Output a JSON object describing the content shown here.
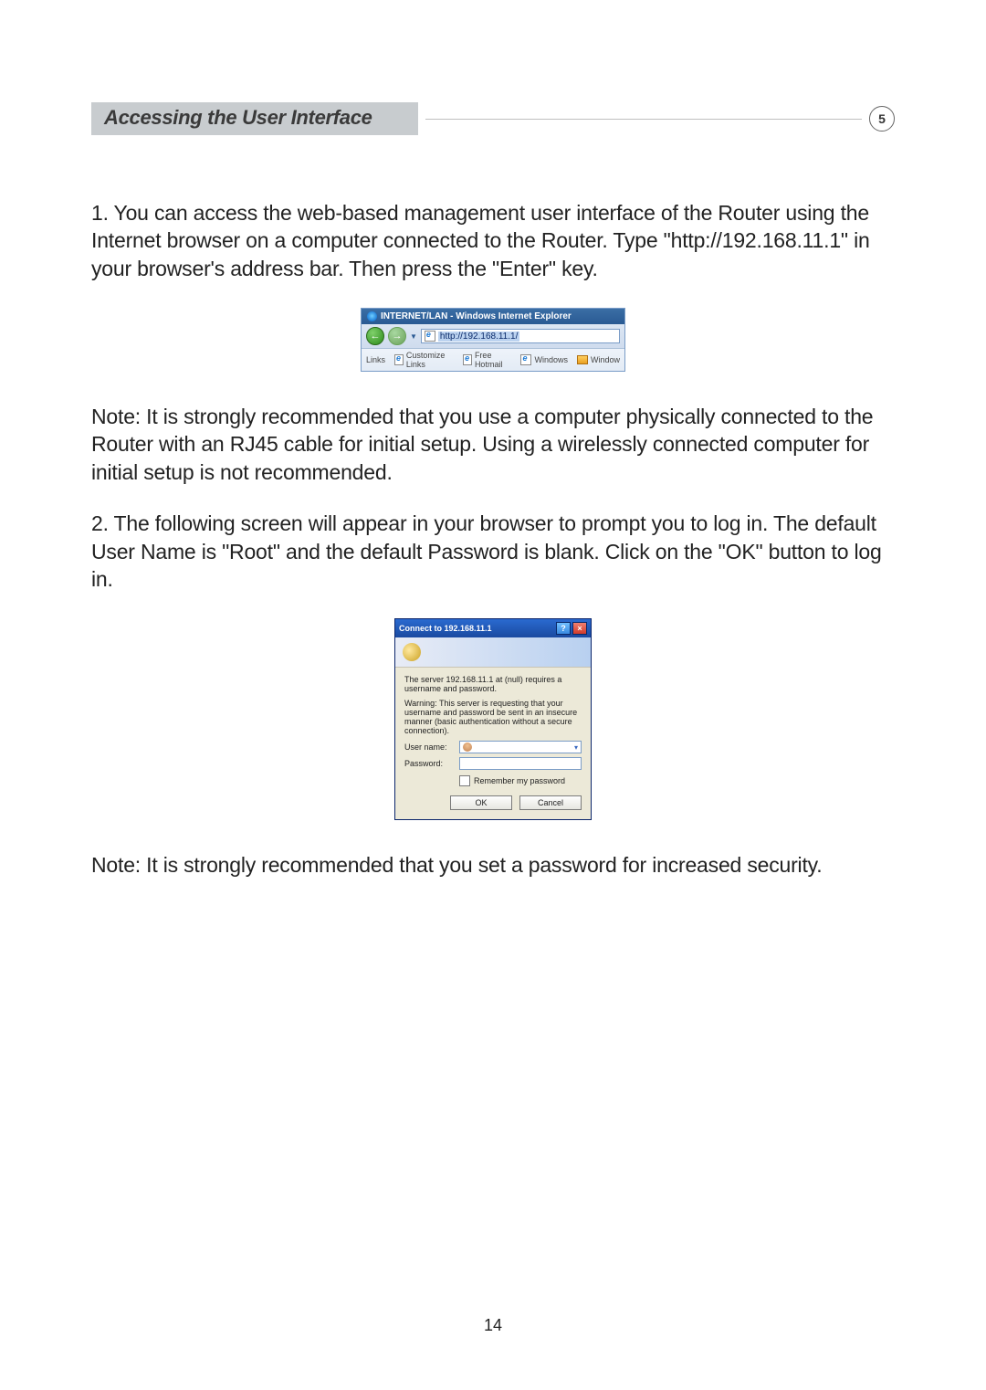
{
  "section": {
    "title": "Accessing the User Interface",
    "number": "5"
  },
  "paragraphs": {
    "p1": "1. You can access the web-based management user interface of the Router using the Internet browser on a computer connected to the Router. Type \"http://192.168.11.1\" in your browser's address bar. Then press the \"Enter\" key.",
    "note1": "Note: It is strongly recommended that you use a computer physically connected to the Router with an RJ45 cable for initial setup. Using a wirelessly connected computer for initial setup is not recommended.",
    "p2": "2. The following screen will appear in your browser to prompt you to log in. The default User Name is \"Root\" and the default Password is blank. Click on the \"OK\" button to log in.",
    "note2": "Note: It is strongly recommended that you set a password for increased security."
  },
  "browser": {
    "window_title": "INTERNET/LAN - Windows Internet Explorer",
    "back_arrow": "←",
    "fwd_arrow": "→",
    "url": "http://192.168.11.1/",
    "links_label": "Links",
    "link1": "Customize Links",
    "link2": "Free Hotmail",
    "link3": "Windows",
    "link4": "Window"
  },
  "dialog": {
    "title": "Connect to 192.168.11.1",
    "help": "?",
    "close": "×",
    "msg1": "The server 192.168.11.1 at (null) requires a username and password.",
    "msg2": "Warning: This server is requesting that your username and password be sent in an insecure manner (basic authentication without a secure connection).",
    "username_label": "User name:",
    "password_label": "Password:",
    "remember": "Remember my password",
    "ok": "OK",
    "cancel": "Cancel"
  },
  "page_number": "14"
}
